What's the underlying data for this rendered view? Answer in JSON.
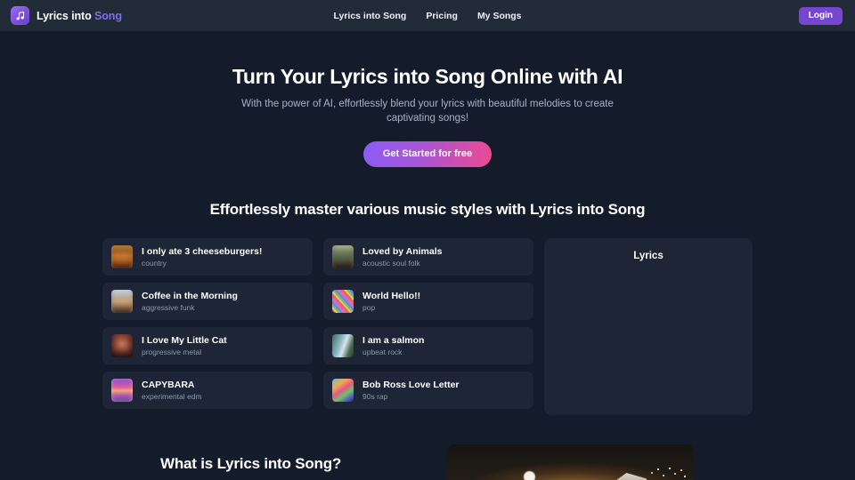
{
  "header": {
    "logo_icon": "music-note-icon",
    "brand_primary": "Lyrics into ",
    "brand_accent": "Song",
    "nav": [
      {
        "label": "Lyrics into Song"
      },
      {
        "label": "Pricing"
      },
      {
        "label": "My Songs"
      }
    ],
    "login_label": "Login"
  },
  "hero": {
    "title": "Turn Your Lyrics into Song Online with AI",
    "subtitle": "With the power of AI, effortlessly blend your lyrics with beautiful melodies to create captivating songs!",
    "cta_label": "Get Started for free"
  },
  "styles_section": {
    "title": "Effortlessly master various music styles with Lyrics into Song",
    "columns": [
      {
        "songs": [
          {
            "title": "I only ate 3 cheeseburgers!",
            "genre": "country",
            "thumb": "burger-diner-thumbnail"
          },
          {
            "title": "Coffee in the Morning",
            "genre": "aggressive funk",
            "thumb": "coffee-cityscape-thumbnail"
          },
          {
            "title": "I Love My Little Cat",
            "genre": "progressive metal",
            "thumb": "cat-portrait-thumbnail"
          },
          {
            "title": " CAPYBARA",
            "genre": "experimental edm",
            "thumb": "sunset-water-thumbnail"
          }
        ]
      },
      {
        "songs": [
          {
            "title": "Loved by Animals",
            "genre": "acoustic soul folk",
            "thumb": "forest-animals-thumbnail"
          },
          {
            "title": "World Hello!!",
            "genre": "pop",
            "thumb": "confetti-crowd-thumbnail"
          },
          {
            "title": "I am a salmon",
            "genre": "upbeat rock",
            "thumb": "waterfall-salmon-thumbnail"
          },
          {
            "title": "Bob Ross Love Letter",
            "genre": "90s rap",
            "thumb": "painting-landscape-thumbnail"
          }
        ]
      }
    ],
    "lyrics_panel": {
      "title": "Lyrics",
      "body": ""
    }
  },
  "about_section": {
    "title": "What is Lyrics into Song?",
    "preview_image": "night-sky-scene-image"
  },
  "colors": {
    "page_background": "#141b2b",
    "header_background": "#222b38",
    "card_background": "#1d2537",
    "accent_purple": "#7f6dea",
    "login_purple": "#7746cf",
    "cta_gradient_start": "#8b5cf6",
    "cta_gradient_end": "#ec4a91",
    "muted_text": "#8e98ac"
  }
}
